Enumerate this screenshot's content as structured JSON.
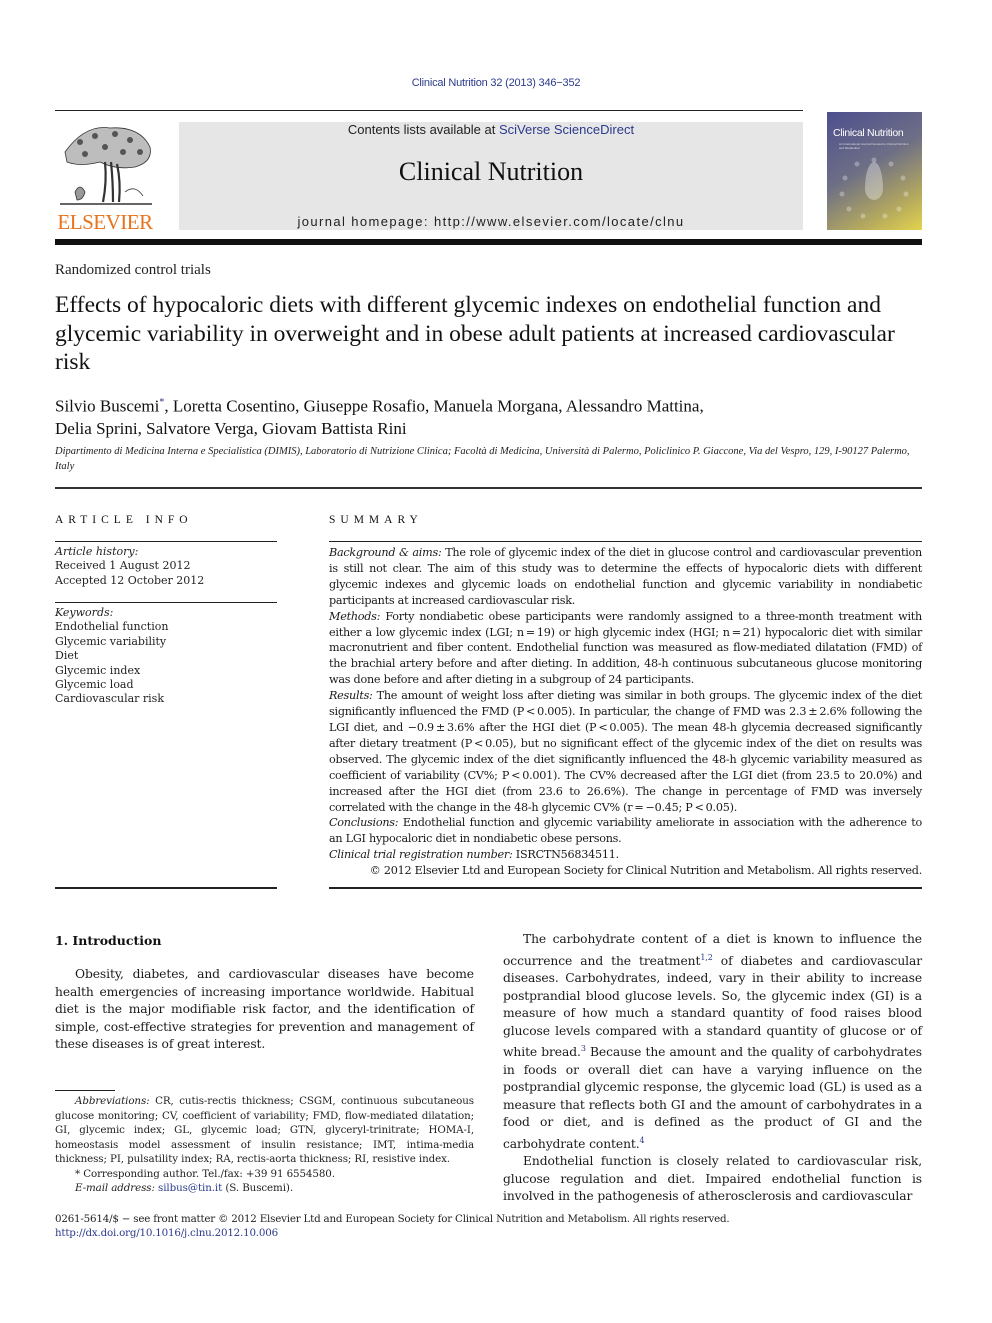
{
  "header": {
    "journal_citation": "Clinical Nutrition 32 (2013) 346−352",
    "publisher_logo_text": "ELSEVIER",
    "contents_prefix": "Contents lists available at ",
    "contents_link": "SciVerse ScienceDirect",
    "journal_title": "Clinical Nutrition",
    "homepage": "journal homepage: http://www.elsevier.com/locate/clnu",
    "cover": {
      "title": "Clinical Nutrition",
      "subtitle": "An International Journal Devoted to Clinical Nutrition and Metabolism"
    },
    "colors": {
      "link": "#2b3a8c",
      "elsevier_orange": "#e8731c",
      "banner_bg": "#e6e6e6"
    }
  },
  "article": {
    "section_type": "Randomized control trials",
    "title": "Effects of hypocaloric diets with different glycemic indexes on endothelial function and glycemic variability in overweight and in obese adult patients at increased cardiovascular risk",
    "authors_line1_a": "Silvio Buscemi",
    "authors_mark": "*",
    "authors_line1_b": ", Loretta Cosentino, Giuseppe Rosafio, Manuela Morgana, Alessandro Mattina,",
    "authors_line2": "Delia Sprini, Salvatore Verga, Giovam Battista Rini",
    "affiliation": "Dipartimento di Medicina Interna e Specialistica (DIMIS), Laboratorio di Nutrizione Clinica; Facoltà di Medicina, Università di Palermo, Policlinico P. Giaccone, Via del Vespro, 129, I-90127 Palermo, Italy"
  },
  "article_info": {
    "heading": "ARTICLE INFO",
    "history_label": "Article history:",
    "received": "Received 1 August 2012",
    "accepted": "Accepted 12 October 2012",
    "keywords_label": "Keywords:",
    "keywords": [
      "Endothelial function",
      "Glycemic variability",
      "Diet",
      "Glycemic index",
      "Glycemic load",
      "Cardiovascular risk"
    ]
  },
  "summary": {
    "heading": "SUMMARY",
    "background_label": "Background & aims:",
    "background": " The role of glycemic index of the diet in glucose control and cardiovascular prevention is still not clear. The aim of this study was to determine the effects of hypocaloric diets with different glycemic indexes and glycemic loads on endothelial function and glycemic variability in nondiabetic participants at increased cardiovascular risk.",
    "methods_label": "Methods:",
    "methods": " Forty nondiabetic obese participants were randomly assigned to a three-month treatment with either a low glycemic index (LGI; n = 19) or high glycemic index (HGI; n = 21) hypocaloric diet with similar macronutrient and fiber content. Endothelial function was measured as flow-mediated dilatation (FMD) of the brachial artery before and after dieting. In addition, 48-h continuous subcutaneous glucose monitoring was done before and after dieting in a subgroup of 24 participants.",
    "results_label": "Results:",
    "results": " The amount of weight loss after dieting was similar in both groups. The glycemic index of the diet significantly influenced the FMD (P < 0.005). In particular, the change of FMD was 2.3 ± 2.6% following the LGI diet, and −0.9 ± 3.6% after the HGI diet (P < 0.005). The mean 48-h glycemia decreased significantly after dietary treatment (P < 0.05), but no significant effect of the glycemic index of the diet on results was observed. The glycemic index of the diet significantly influenced the 48-h glycemic variability measured as coefficient of variability (CV%; P < 0.001). The CV% decreased after the LGI diet (from 23.5 to 20.0%) and increased after the HGI diet (from 23.6 to 26.6%). The change in percentage of FMD was inversely correlated with the change in the 48-h glycemic CV% (r = −0.45; P < 0.05).",
    "conclusions_label": "Conclusions:",
    "conclusions": " Endothelial function and glycemic variability ameliorate in association with the adherence to an LGI hypocaloric diet in nondiabetic obese persons.",
    "registration_label": "Clinical trial registration number:",
    "registration": " ISRCTN56834511.",
    "copyright": "© 2012 Elsevier Ltd and European Society for Clinical Nutrition and Metabolism. All rights reserved."
  },
  "introduction": {
    "heading": "1.  Introduction",
    "para1": "Obesity, diabetes, and cardiovascular diseases have become health emergencies of increasing importance worldwide. Habitual diet is the major modifiable risk factor, and the identification of simple, cost-effective strategies for prevention and management of these diseases is of great interest.",
    "para2_a": "The carbohydrate content of a diet is known to influence the occurrence and the treatment",
    "para2_ref1": "1,2",
    "para2_b": " of diabetes and cardiovascular diseases. Carbohydrates, indeed, vary in their ability to increase postprandial blood glucose levels. So, the glycemic index (GI) is a measure of how much a standard quantity of food raises blood glucose levels compared with a standard quantity of glucose or of white bread.",
    "para2_ref2": "3",
    "para2_c": " Because the amount and the quality of carbohydrates in foods or overall diet can have a varying influence on the postprandial glycemic response, the glycemic load (GL) is used as a measure that reflects both GI and the amount of carbohydrates in a food or diet, and is defined as the product of GI and the carbohydrate content.",
    "para2_ref3": "4",
    "para3": "Endothelial function is closely related to cardiovascular risk, glucose regulation and diet. Impaired endothelial function is involved in the pathogenesis of atherosclerosis and cardiovascular"
  },
  "footnotes": {
    "abbrev_label": "Abbreviations:",
    "abbreviations": " CR, cutis-rectis thickness; CSGM, continuous subcutaneous glucose monitoring; CV, coefficient of variability; FMD, flow-mediated dilatation; GI, glycemic index; GL, glycemic load; GTN, glyceryl-trinitrate; HOMA-I, homeostasis model assessment of insulin resistance; IMT, intima-media thickness; PI, pulsatility index; RA, rectis-aorta thickness; RI, resistive index.",
    "corresponding": "* Corresponding author. Tel./fax: +39 91 6554580.",
    "email_label": "E-mail address:",
    "email": "silbus@tin.it",
    "email_suffix": " (S. Buscemi)."
  },
  "bottom": {
    "issn_line": "0261-5614/$ − see front matter © 2012 Elsevier Ltd and European Society for Clinical Nutrition and Metabolism. All rights reserved.",
    "doi": "http://dx.doi.org/10.1016/j.clnu.2012.10.006"
  }
}
